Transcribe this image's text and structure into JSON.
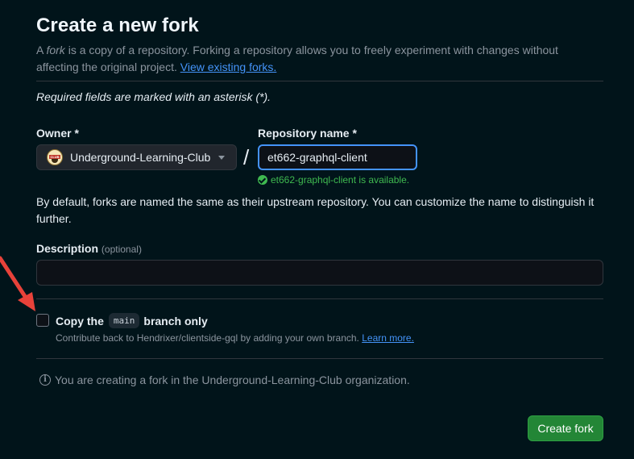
{
  "header": {
    "title": "Create a new fork",
    "intro_prefix": "A ",
    "intro_fork_word": "fork",
    "intro_body": " is a copy of a repository. Forking a repository allows you to freely experiment with changes without affecting the original project. ",
    "view_forks_link": "View existing forks."
  },
  "form": {
    "required_note": "Required fields are marked with an asterisk (*).",
    "owner": {
      "label": "Owner *",
      "selected": "Underground-Learning-Club",
      "avatar_text": "CLUB",
      "icon": "chevron-down-icon"
    },
    "separator": "/",
    "repository": {
      "label": "Repository name *",
      "value": "et662-graphql-client",
      "availability": "et662-graphql-client is available."
    },
    "default_note": "By default, forks are named the same as their upstream repository. You can customize the name to distinguish it further.",
    "description": {
      "label": "Description",
      "optional": "(optional)",
      "value": ""
    },
    "copy_branch": {
      "label_prefix": "Copy the",
      "branch": "main",
      "label_suffix": "branch only",
      "checked": false,
      "help_text": "Contribute back to Hendrixer/clientside-gql by adding your own branch. ",
      "learn_more": "Learn more."
    },
    "info": "You are creating a fork in the Underground-Learning-Club organization.",
    "submit_label": "Create fork"
  },
  "colors": {
    "background": "#01141a",
    "accent_link": "#4493f8",
    "success": "#3fb950",
    "primary_button": "#238636",
    "annotation_arrow": "#e8423a"
  }
}
